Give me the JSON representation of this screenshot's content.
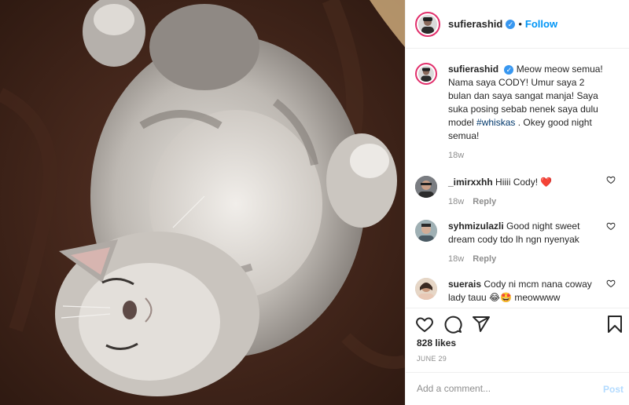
{
  "post": {
    "username": "sufierashid",
    "follow_label": "Follow",
    "dot": "•",
    "caption_text": "Meow meow semua! Nama saya CODY! Umur saya 2 bulan dan saya sangat manja! Saya suka posing sebab nenek saya dulu model",
    "caption_hashtag": "#whiskas",
    "caption_end": ". Okey good night semua!",
    "caption_time": "18w",
    "photo_icon": "sleeping-kitten-photo"
  },
  "comments": [
    {
      "username": "_imirxxhh",
      "text": "Hiiii Cody!",
      "emoji": "❤️",
      "time": "18w",
      "reply": "Reply"
    },
    {
      "username": "syhmizulazli",
      "text": "Good night sweet dream cody tdo lh ngn nyenyak",
      "time": "18w",
      "reply": "Reply"
    },
    {
      "username": "suerais",
      "text": "Cody ni mcm nana coway lady tauu",
      "emoji": "😂🤩",
      "text_end": "meowwww"
    }
  ],
  "likes": "828 likes",
  "date": "JUNE 29",
  "add_comment": {
    "placeholder": "Add a comment...",
    "post_label": "Post"
  },
  "colors": {
    "accent": "#0095f6",
    "heart": "#ed4956",
    "post_disabled": "#b3dbff",
    "verified": "#3897f0"
  },
  "icons": [
    "heart-icon",
    "comment-icon",
    "share-icon",
    "bookmark-icon",
    "verified-icon"
  ]
}
